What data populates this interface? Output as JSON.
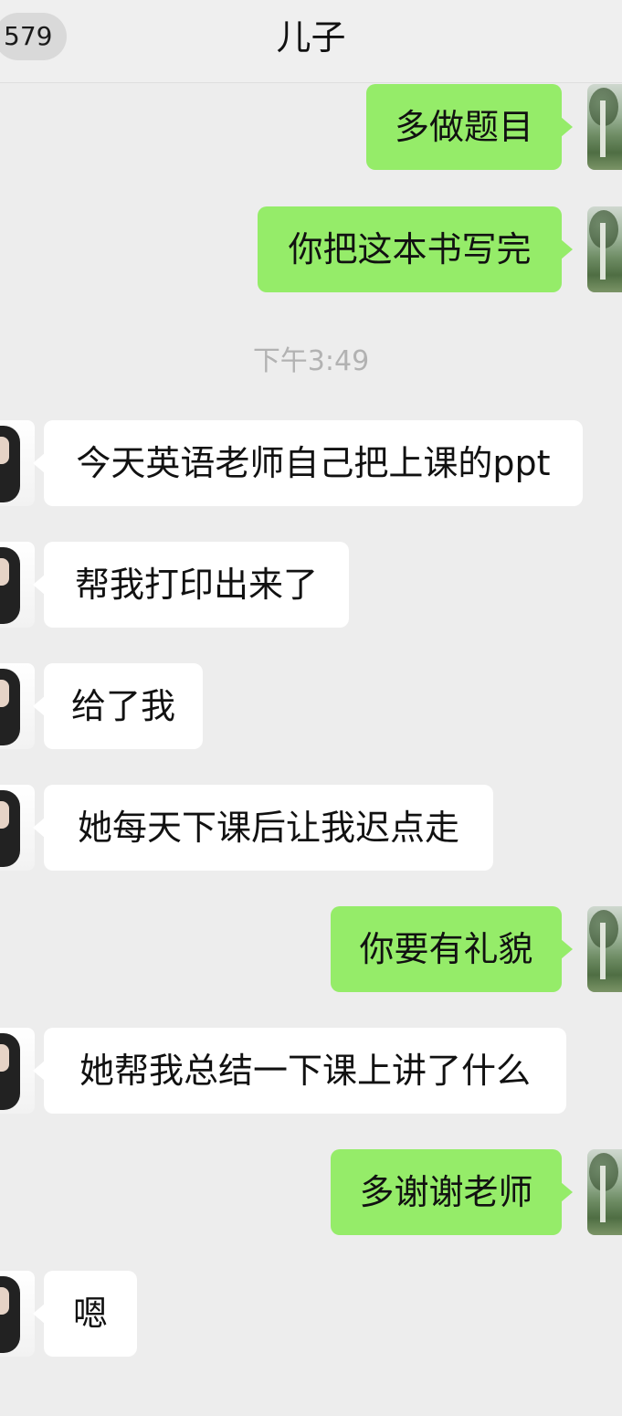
{
  "header": {
    "back_badge": "579",
    "title": "儿子"
  },
  "timestamp": "下午3:49",
  "messages": [
    {
      "sender": "me",
      "text": "多做题目"
    },
    {
      "sender": "me",
      "text": "你把这本书写完"
    },
    {
      "sender": "son",
      "text": "今天英语老师自己把上课的ppt"
    },
    {
      "sender": "son",
      "text": "帮我打印出来了"
    },
    {
      "sender": "son",
      "text": "给了我"
    },
    {
      "sender": "son",
      "text": "她每天下课后让我迟点走"
    },
    {
      "sender": "me",
      "text": "你要有礼貌"
    },
    {
      "sender": "son",
      "text": "她帮我总结一下课上讲了什么"
    },
    {
      "sender": "me",
      "text": "多谢谢老师"
    },
    {
      "sender": "son",
      "text": "嗯"
    }
  ],
  "colors": {
    "background": "#ededed",
    "outgoing_bubble": "#95ec69",
    "incoming_bubble": "#ffffff",
    "timestamp": "#b2b2b2"
  }
}
